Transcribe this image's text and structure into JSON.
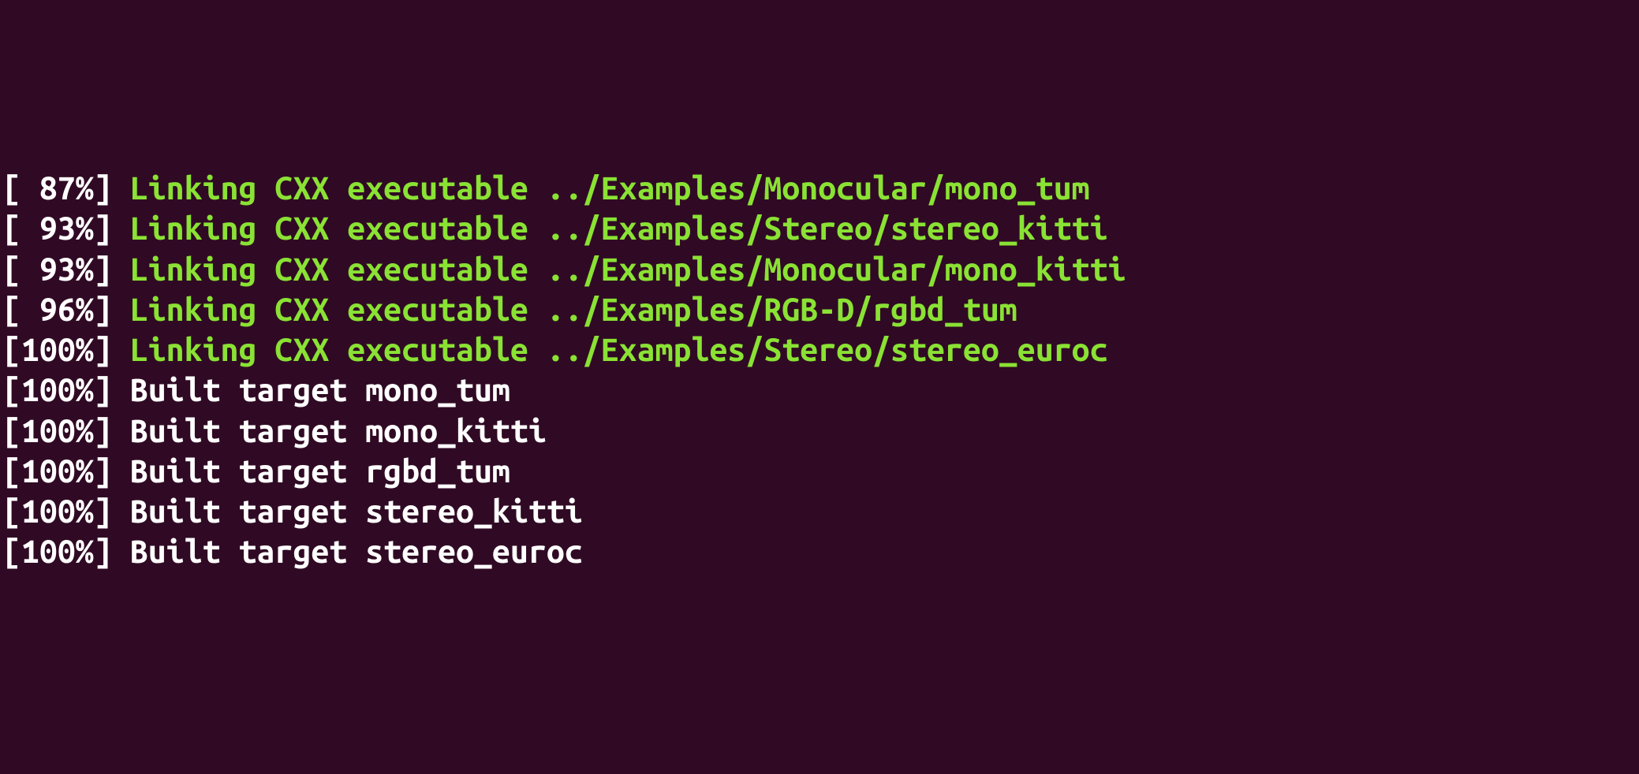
{
  "lines": [
    {
      "percent": "[ 87%]",
      "type": "link",
      "msg": "Linking CXX executable ../Examples/Monocular/mono_tum"
    },
    {
      "percent": "[ 93%]",
      "type": "link",
      "msg": "Linking CXX executable ../Examples/Stereo/stereo_kitti"
    },
    {
      "percent": "[ 93%]",
      "type": "link",
      "msg": "Linking CXX executable ../Examples/Monocular/mono_kitti"
    },
    {
      "percent": "[ 96%]",
      "type": "link",
      "msg": "Linking CXX executable ../Examples/RGB-D/rgbd_tum"
    },
    {
      "percent": "[100%]",
      "type": "link",
      "msg": "Linking CXX executable ../Examples/Stereo/stereo_euroc"
    },
    {
      "percent": "[100%]",
      "type": "built",
      "msg": "Built target mono_tum"
    },
    {
      "percent": "[100%]",
      "type": "built",
      "msg": "Built target mono_kitti"
    },
    {
      "percent": "[100%]",
      "type": "built",
      "msg": "Built target rgbd_tum"
    },
    {
      "percent": "[100%]",
      "type": "built",
      "msg": "Built target stereo_kitti"
    },
    {
      "percent": "[100%]",
      "type": "built",
      "msg": "Built target stereo_euroc"
    }
  ]
}
